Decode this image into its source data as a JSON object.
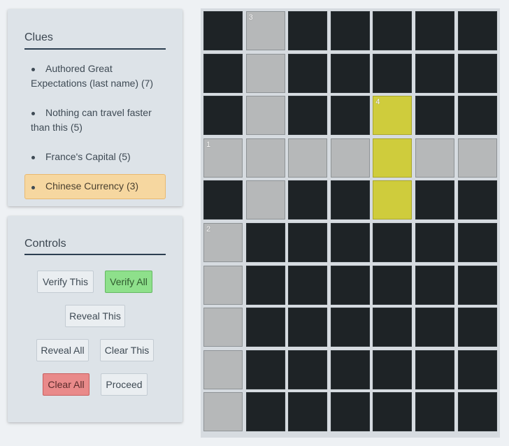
{
  "clues": {
    "title": "Clues",
    "items": [
      {
        "text": "Authored Great Expectations (last name) (7)",
        "active": false
      },
      {
        "text": "Nothing can travel faster than this (5)",
        "active": false
      },
      {
        "text": "France's Capital (5)",
        "active": false
      },
      {
        "text": "Chinese Currency (3)",
        "active": true
      }
    ]
  },
  "controls": {
    "title": "Controls",
    "verify_this": "Verify This",
    "verify_all": "Verify All",
    "reveal_this": "Reveal This",
    "reveal_all": "Reveal All",
    "clear_this": "Clear This",
    "clear_all": "Clear All",
    "proceed": "Proceed"
  },
  "board": {
    "cols": 7,
    "rows": 10,
    "grid": [
      [
        "B",
        "O3",
        "B",
        "B",
        "B",
        "B",
        "B"
      ],
      [
        "B",
        "O",
        "B",
        "B",
        "B",
        "B",
        "B"
      ],
      [
        "B",
        "O",
        "B",
        "B",
        "H4",
        "B",
        "B"
      ],
      [
        "O1",
        "O",
        "O",
        "O",
        "H",
        "O",
        "O"
      ],
      [
        "B",
        "O",
        "B",
        "B",
        "H",
        "B",
        "B"
      ],
      [
        "O2",
        "B",
        "B",
        "B",
        "B",
        "B",
        "B"
      ],
      [
        "O",
        "B",
        "B",
        "B",
        "B",
        "B",
        "B"
      ],
      [
        "O",
        "B",
        "B",
        "B",
        "B",
        "B",
        "B"
      ],
      [
        "O",
        "B",
        "B",
        "B",
        "B",
        "B",
        "B"
      ],
      [
        "O",
        "B",
        "B",
        "B",
        "B",
        "B",
        "B"
      ]
    ],
    "colors": {
      "block": "#1e2326",
      "open": "#b6b8b9",
      "highlight": "#cfcc3c"
    }
  }
}
